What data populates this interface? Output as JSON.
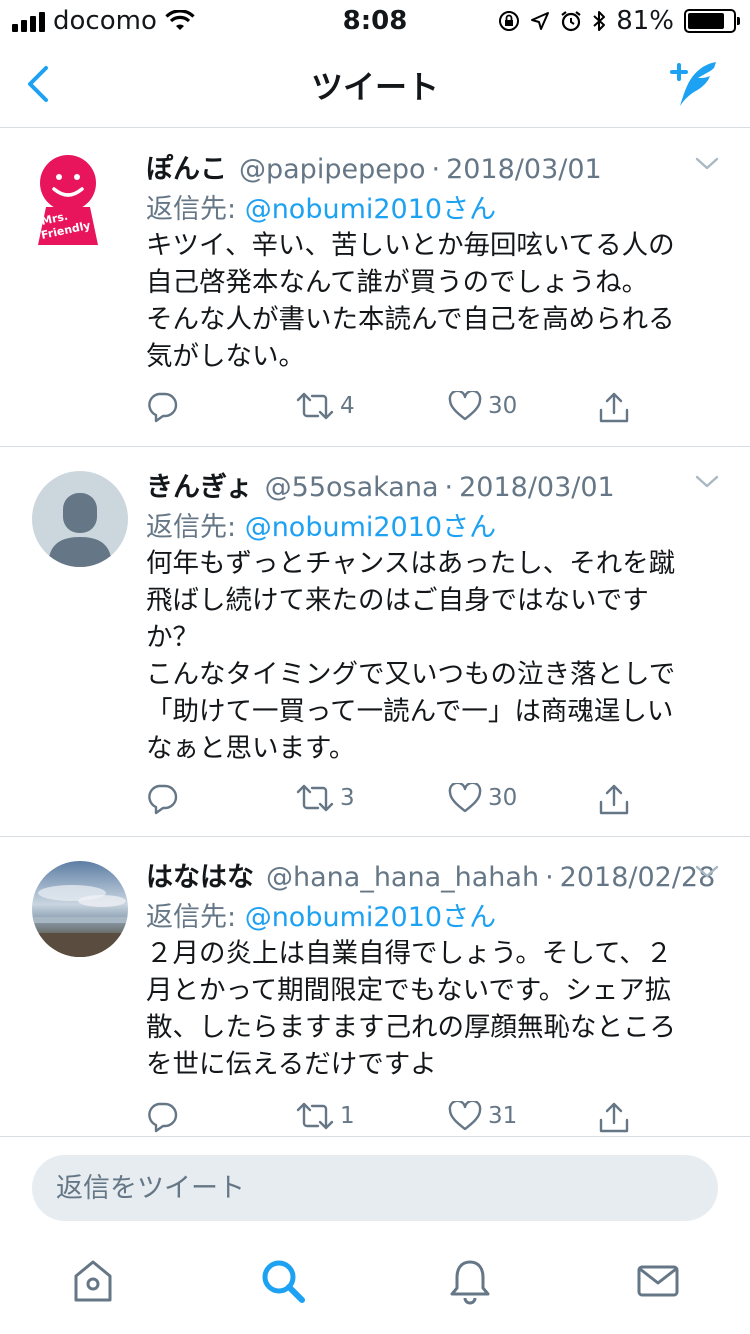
{
  "status_bar": {
    "carrier": "docomo",
    "time": "8:08",
    "battery": "81%",
    "battery_level": 0.81
  },
  "header": {
    "title": "ツイート",
    "back_icon": "chevron-left-icon",
    "compose_icon": "compose-tweet-icon",
    "accent": "#1da1f2"
  },
  "tweets": [
    {
      "name": "ぽんこ",
      "handle": "@papipepepo",
      "sep": "·",
      "date": "2018/03/01",
      "reply_prefix": "返信先: ",
      "reply_to": "@nobumi2010さん",
      "text": "キツイ、辛い、苦しいとか毎回呟いてる人の\n自己啓発本なんて誰が買うのでしょうね。\nそんな人が書いた本読んで自己を高められる\n気がしない。",
      "retweets": "4",
      "likes": "30",
      "avatar_logo_text": "Mrs. Friendly"
    },
    {
      "name": "きんぎょ",
      "handle": "@55osakana",
      "sep": "·",
      "date": "2018/03/01",
      "reply_prefix": "返信先: ",
      "reply_to": "@nobumi2010さん",
      "text": "何年もずっとチャンスはあったし、それを蹴\n飛ばし続けて来たのはご自身ではないです\nか？\nこんなタイミングで又いつもの泣き落としで\n「助けて一買って一読んで一」は商魂逞しい\nなぁと思います。",
      "retweets": "3",
      "likes": "30"
    },
    {
      "name": "はなはな",
      "handle": "@hana_hana_hahah",
      "sep": "·",
      "date": "2018/02/28",
      "reply_prefix": "返信先: ",
      "reply_to": "@nobumi2010さん",
      "text": "２月の炎上は自業自得でしょう。そして、２\n月とかって期間限定でもないです。シェア拡\n散、したらますます己れの厚顔無恥なところ\nを世に伝えるだけですよ",
      "retweets": "1",
      "likes": "31"
    }
  ],
  "composer": {
    "placeholder": "返信をツイート"
  },
  "tabbar": {
    "items": [
      "home-icon",
      "search-icon",
      "notifications-icon",
      "messages-icon"
    ],
    "active": "search-icon"
  }
}
